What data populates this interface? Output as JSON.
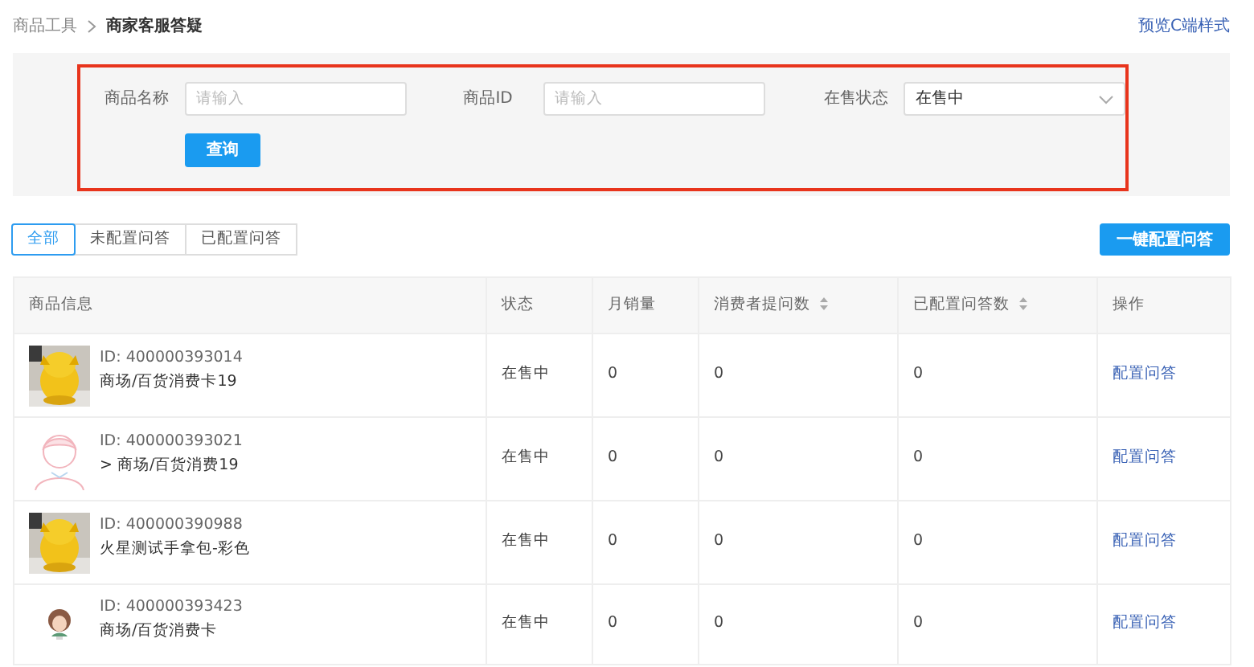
{
  "breadcrumb": [
    "商品工具",
    "商家客服答疑"
  ],
  "preview_link": "预览C端样式",
  "filters": [
    {
      "label": "商品名称",
      "kind": "input",
      "placeholder": "请输入"
    },
    {
      "label": "商品ID",
      "kind": "input",
      "placeholder": "请输入"
    },
    {
      "label": "在售状态",
      "kind": "select",
      "value": "在售中"
    }
  ],
  "query_button": "查询",
  "tabs": [
    {
      "label": "全部",
      "selected": true
    },
    {
      "label": "未配置问答",
      "selected": false
    },
    {
      "label": "已配置问答",
      "selected": false
    }
  ],
  "bulk_button": "一键配置问答",
  "table": {
    "columns": [
      {
        "label": "商品信息",
        "sortable": false
      },
      {
        "label": "状态",
        "sortable": false
      },
      {
        "label": "月销量",
        "sortable": false
      },
      {
        "label": "消费者提问数",
        "sortable": true
      },
      {
        "label": "已配置问答数",
        "sortable": true
      },
      {
        "label": "操作",
        "sortable": false
      }
    ],
    "rows": [
      {
        "id": "ID: 400000393014",
        "name": "商场/百货消费卡19",
        "status": "在售中",
        "monthly_sales": "0",
        "questions": "0",
        "answers": "0",
        "action": "配置问答"
      },
      {
        "id": "ID: 400000393021",
        "name": "> 商场/百货消费19",
        "status": "在售中",
        "monthly_sales": "0",
        "questions": "0",
        "answers": "0",
        "action": "配置问答"
      },
      {
        "id": "ID: 400000390988",
        "name": "火星测试手拿包-彩色",
        "status": "在售中",
        "monthly_sales": "0",
        "questions": "0",
        "answers": "0",
        "action": "配置问答"
      },
      {
        "id": "ID: 400000393423",
        "name": "商场/百货消费卡",
        "status": "在售中",
        "monthly_sales": "0",
        "questions": "0",
        "answers": "0",
        "action": "配置问答"
      }
    ]
  }
}
